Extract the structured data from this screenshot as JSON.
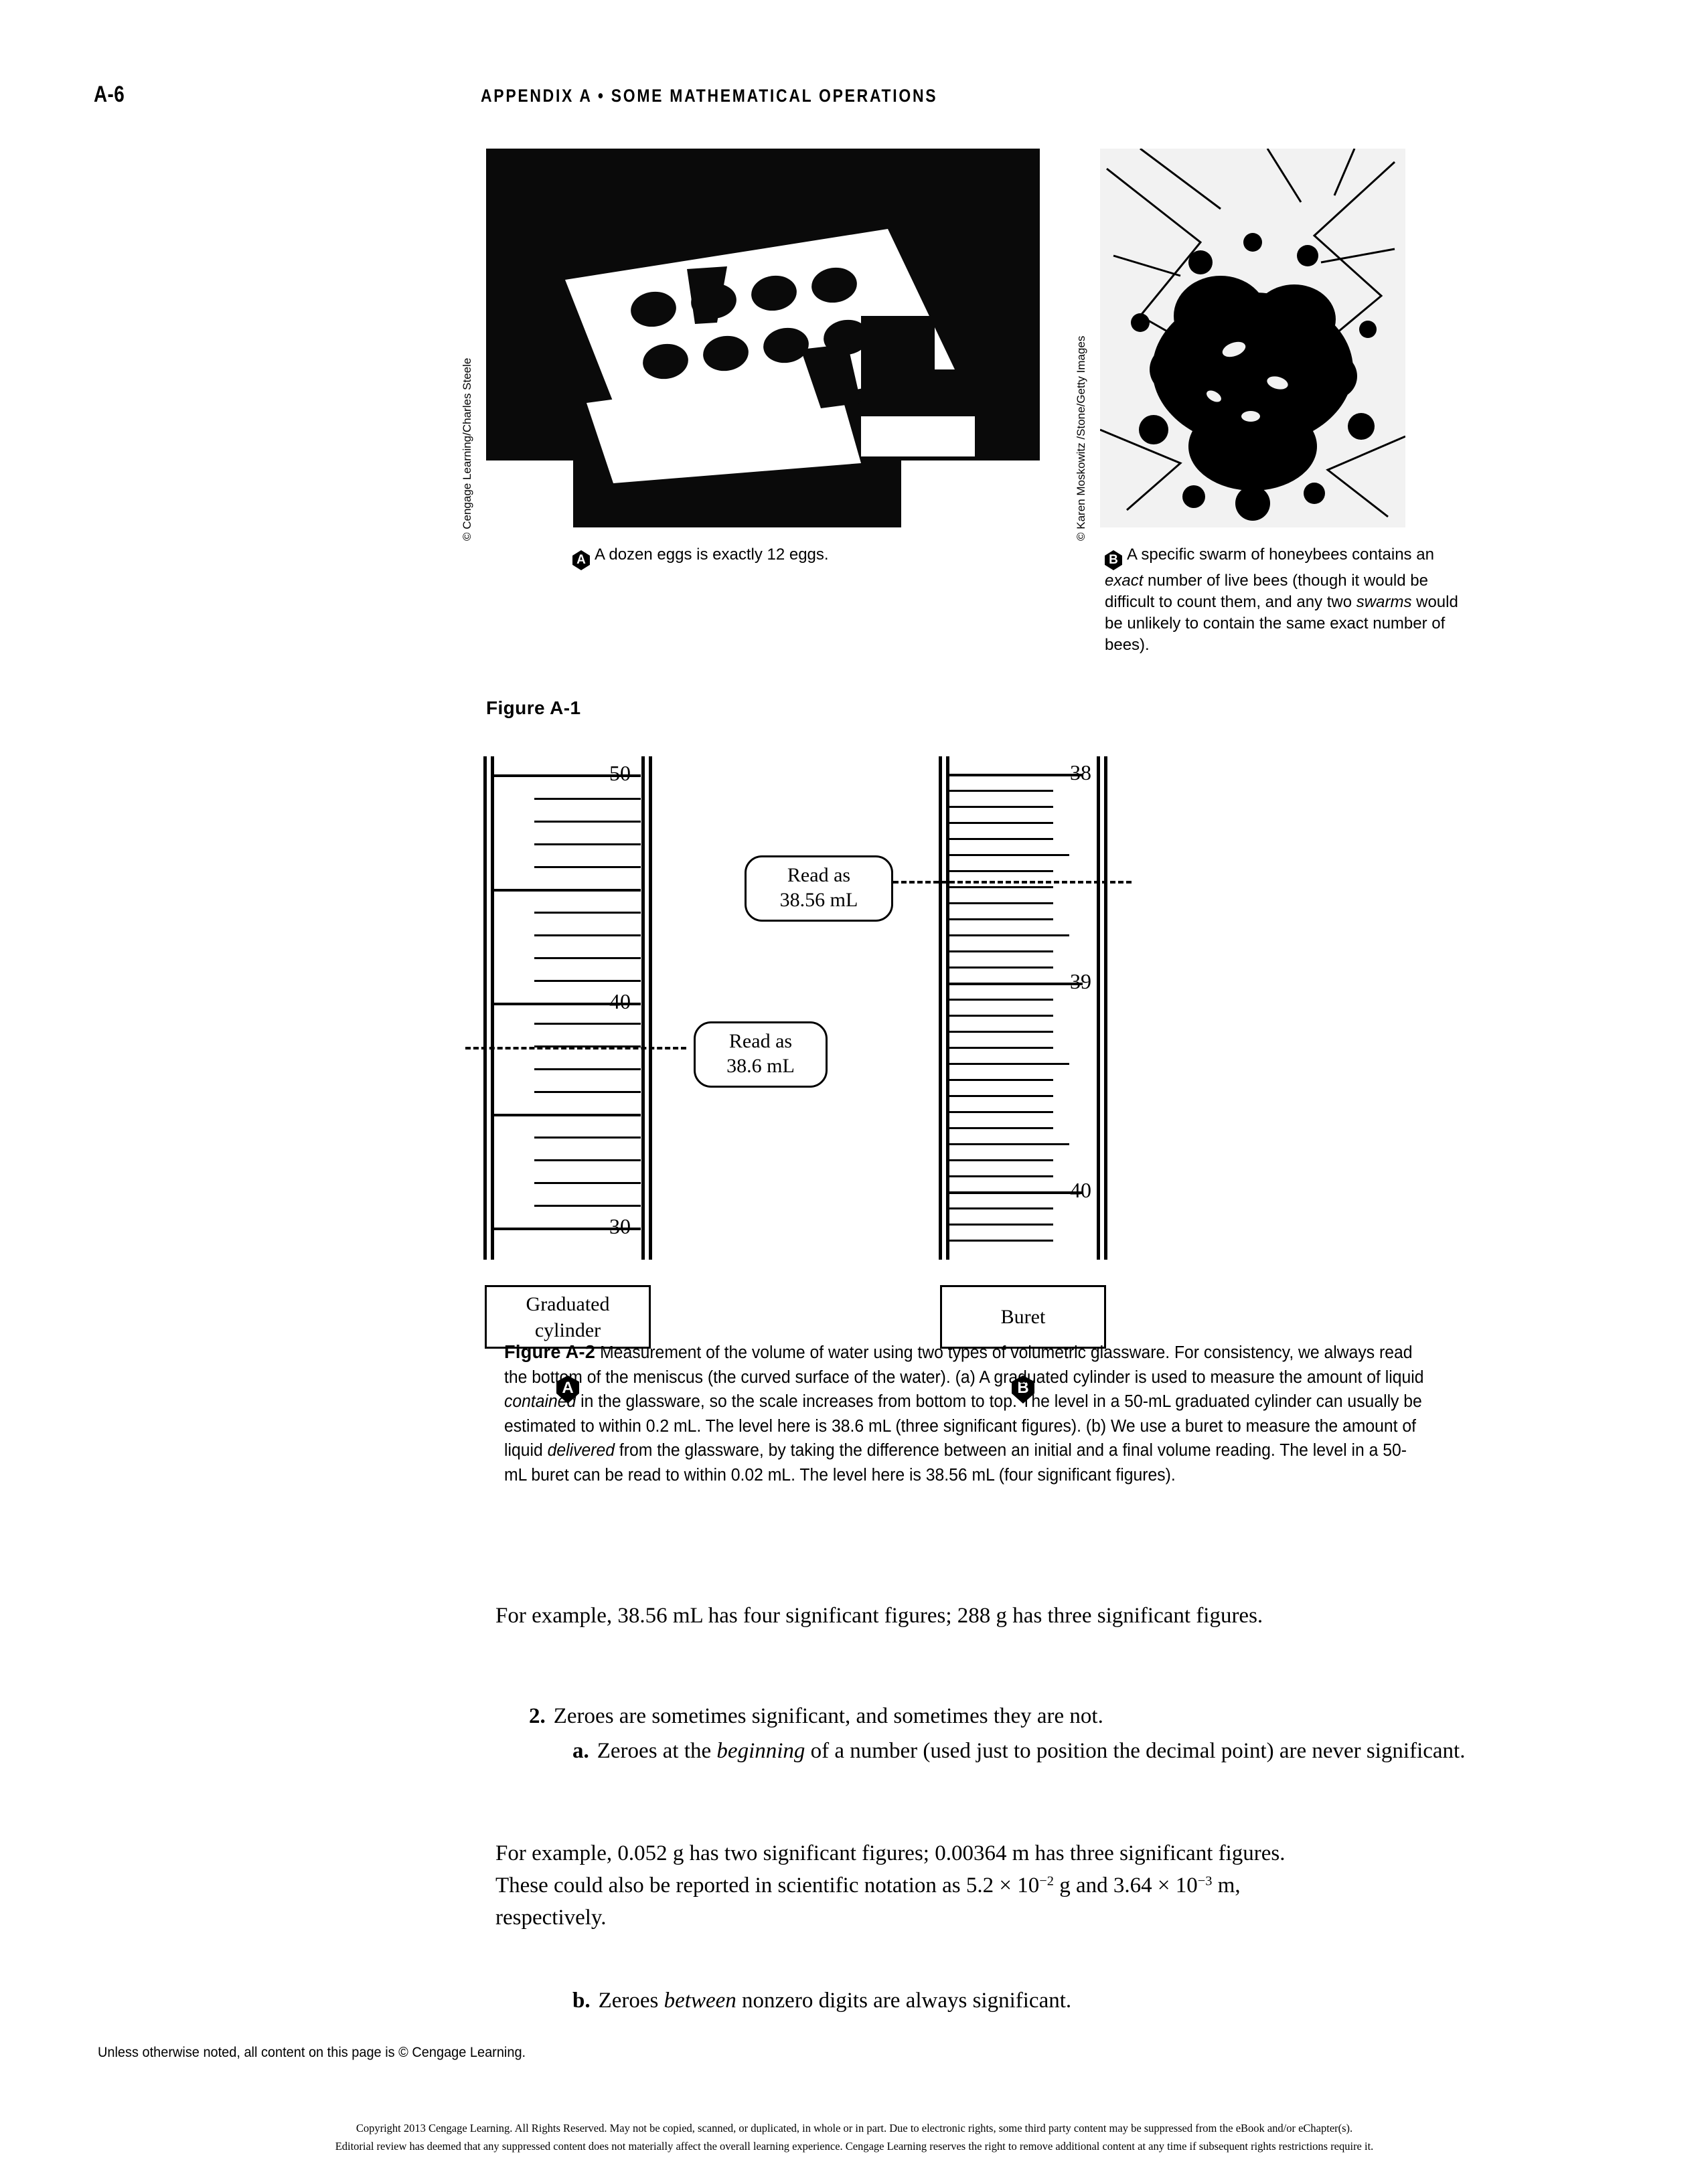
{
  "header": {
    "folio": "A-6",
    "running_head": "APPENDIX A • SOME MATHEMATICAL OPERATIONS"
  },
  "photos": {
    "eggs": {
      "credit": "© Cengage Learning/Charles Steele",
      "badge": "A",
      "caption": "A dozen eggs is exactly 12 eggs."
    },
    "bees": {
      "credit": "© Karen Moskowitz /Stone/Getty Images",
      "badge": "B",
      "caption_part1": "A specific swarm of honeybees contains an ",
      "caption_em1": "exact",
      "caption_part2": " number of live bees (though it would be difficult to count them, and any two ",
      "caption_em2": "swarms",
      "caption_part3": " would be unlikely to contain the same exact number of bees)."
    }
  },
  "figure_a1": {
    "label": "Figure A-1"
  },
  "figure_a2": {
    "label": "Figure A-2",
    "caption_1": " Measurement of the volume of water using two types of volumetric glassware. For consistency, we always read the bottom of the meniscus (the curved surface of the water). (a) A graduated cylinder is used to measure the amount of liquid ",
    "caption_em1": "contained",
    "caption_2": " in the glassware, so the scale increases from bottom to top. The level in a 50-mL graduated cylinder can usually be estimated to within 0.2 mL. The level here is 38.6 mL (three significant figures). (b) We use a buret to measure the amount of liquid ",
    "caption_em2": "delivered",
    "caption_3": " from the glassware, by taking the difference between an initial and a final volume reading. The level in a 50-mL buret can be read to within 0.02 mL. The level here is 38.56 mL (four significant figures)."
  },
  "diagram": {
    "cylinder": {
      "box_label_line1": "Graduated",
      "box_label_line2": "cylinder",
      "panel_badge": "A",
      "callout_line1": "Read as",
      "callout_line2": "38.6 mL",
      "scale_labels": [
        "50",
        "40",
        "30"
      ]
    },
    "buret": {
      "box_label": "Buret",
      "panel_badge": "B",
      "callout_line1": "Read as",
      "callout_line2": "38.56 mL",
      "scale_labels": [
        "38",
        "39",
        "40"
      ]
    }
  },
  "body": {
    "para_1": "For example, 38.56 mL has four significant figures; 288 g has three significant figures.",
    "item_2": {
      "marker": "2.",
      "text": "Zeroes are sometimes significant, and sometimes they are not."
    },
    "item_2a": {
      "marker": "a.",
      "text_1": "Zeroes at the ",
      "em": "beginning",
      "text_2": " of a number (used just to position the decimal point) are never significant."
    },
    "para_2_line1": "For example, 0.052 g has two significant figures; 0.00364 m has three significant figures.",
    "para_2_line2_a": "These could also be reported in scientific notation as 5.2 × 10",
    "para_2_sup_a": "−2",
    "para_2_line2_b": " g and 3.64 × 10",
    "para_2_sup_b": "−3",
    "para_2_line2_c": " m,",
    "para_2_line3": "respectively.",
    "item_2b": {
      "marker": "b.",
      "text_1": "Zeroes ",
      "em": "between",
      "text_2": " nonzero digits are always significant."
    }
  },
  "footer": {
    "note": "Unless otherwise noted, all content on this page is © Cengage Learning.",
    "copyright_line1": "Copyright 2013 Cengage Learning. All Rights Reserved. May not be copied, scanned, or duplicated, in whole or in part. Due to electronic rights, some third party content may be suppressed from the eBook and/or eChapter(s).",
    "copyright_line2": "Editorial review has deemed that any suppressed content does not materially affect the overall learning experience. Cengage Learning reserves the right to remove additional content at any time if subsequent rights restrictions require it."
  }
}
